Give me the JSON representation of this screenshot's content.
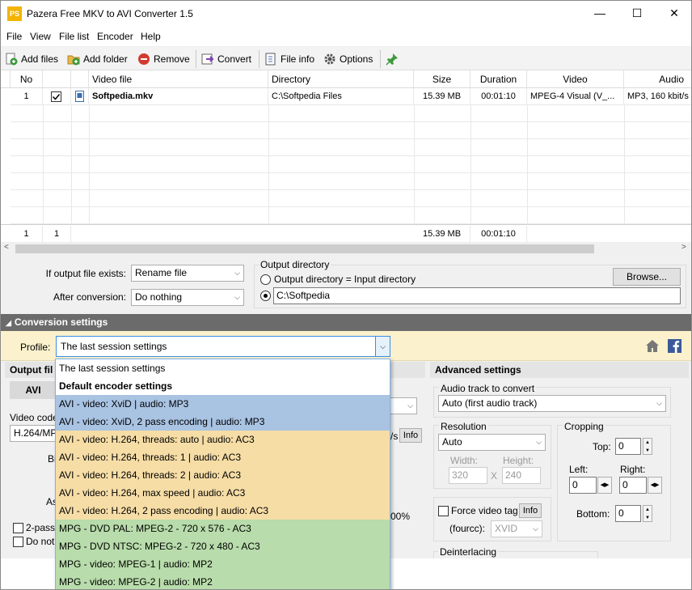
{
  "window": {
    "title": "Pazera Free MKV to AVI Converter 1.5",
    "icon_text": "PS",
    "minimize": "—",
    "maximize": "☐",
    "close": "✕"
  },
  "menu": [
    "File",
    "View",
    "File list",
    "Encoder",
    "Help"
  ],
  "toolbar": {
    "add_files": "Add files",
    "add_folder": "Add folder",
    "remove": "Remove",
    "convert": "Convert",
    "file_info": "File info",
    "options": "Options"
  },
  "file_list": {
    "columns": [
      "No",
      "",
      "Video file",
      "Directory",
      "Size",
      "Duration",
      "Video",
      "Audio"
    ],
    "rows": [
      {
        "no": "1",
        "checked": true,
        "file": "Softpedia.mkv",
        "directory": "C:\\Softpedia Files",
        "size": "15.39 MB",
        "duration": "00:01:10",
        "video": "MPEG-4 Visual (V_...",
        "audio": "MP3, 160 kbit/s"
      }
    ],
    "footer": {
      "count": "1",
      "checked_count": "1",
      "size": "15.39 MB",
      "duration": "00:01:10"
    }
  },
  "options": {
    "if_exists_label": "If output file exists:",
    "if_exists_value": "Rename file",
    "after_conversion_label": "After conversion:",
    "after_conversion_value": "Do nothing",
    "output_dir_title": "Output directory",
    "radio_input_dir": "Output directory = Input directory",
    "output_dir_value": "C:\\Softpedia",
    "browse": "Browse..."
  },
  "conversion": {
    "header": "Conversion settings",
    "profile_label": "Profile:",
    "profile_value": "The last session settings",
    "dropdown": [
      {
        "label": "The last session settings",
        "kind": "plain"
      },
      {
        "label": "Default encoder settings",
        "kind": "bold"
      },
      {
        "label": "AVI - video: XviD | audio: MP3",
        "kind": "blue"
      },
      {
        "label": "AVI - video: XviD, 2 pass encoding | audio: MP3",
        "kind": "blue"
      },
      {
        "label": "AVI - video: H.264, threads: auto | audio: AC3",
        "kind": "orange"
      },
      {
        "label": "AVI - video: H.264, threads: 1 | audio: AC3",
        "kind": "orange"
      },
      {
        "label": "AVI - video: H.264, threads: 2 | audio: AC3",
        "kind": "orange"
      },
      {
        "label": "AVI - video: H.264, max speed | audio: AC3",
        "kind": "orange"
      },
      {
        "label": "AVI - video: H.264, 2 pass encoding | audio: AC3",
        "kind": "orange"
      },
      {
        "label": "MPG - DVD PAL: MPEG-2 - 720 x 576 - AC3",
        "kind": "green"
      },
      {
        "label": "MPG - DVD NTSC: MPEG-2 - 720 x 480 - AC3",
        "kind": "green"
      },
      {
        "label": "MPG - video: MPEG-1 | audio: MP2",
        "kind": "green"
      },
      {
        "label": "MPG - video: MPEG-2 | audio: MP2",
        "kind": "green"
      }
    ],
    "colors": {
      "blue": "#a9c3e3",
      "orange": "#f6dda6",
      "green": "#b8dcab"
    }
  },
  "left_panel": {
    "header_fragment": "Output fil",
    "tab_avi": "AVI",
    "video_codec_fragment": "Video code",
    "codec_fragment": "H.264/MP",
    "bi_fragment": "Bi",
    "as_fragment": "As",
    "twopass_fragment": "2-pass",
    "donot_fragment": "Do not",
    "info": "Info",
    "s_fragment": "/s",
    "percent_fragment": "00%"
  },
  "advanced": {
    "header": "Advanced settings",
    "audio_track_label": "Audio track to convert",
    "audio_track_value": "Auto (first audio track)",
    "resolution_label": "Resolution",
    "resolution_value": "Auto",
    "width_label": "Width:",
    "height_label": "Height:",
    "width_value": "320",
    "height_value": "240",
    "x_sep": "X",
    "cropping_label": "Cropping",
    "top_label": "Top:",
    "left_label": "Left:",
    "right_label": "Right:",
    "bottom_label": "Bottom:",
    "top_value": "0",
    "left_value": "0",
    "right_value": "0",
    "bottom_value": "0",
    "force_tag_label": "Force video tag",
    "info": "Info",
    "fourcc_label": "(fourcc):",
    "fourcc_value": "XVID",
    "deinterlacing_label": "Deinterlacing"
  }
}
